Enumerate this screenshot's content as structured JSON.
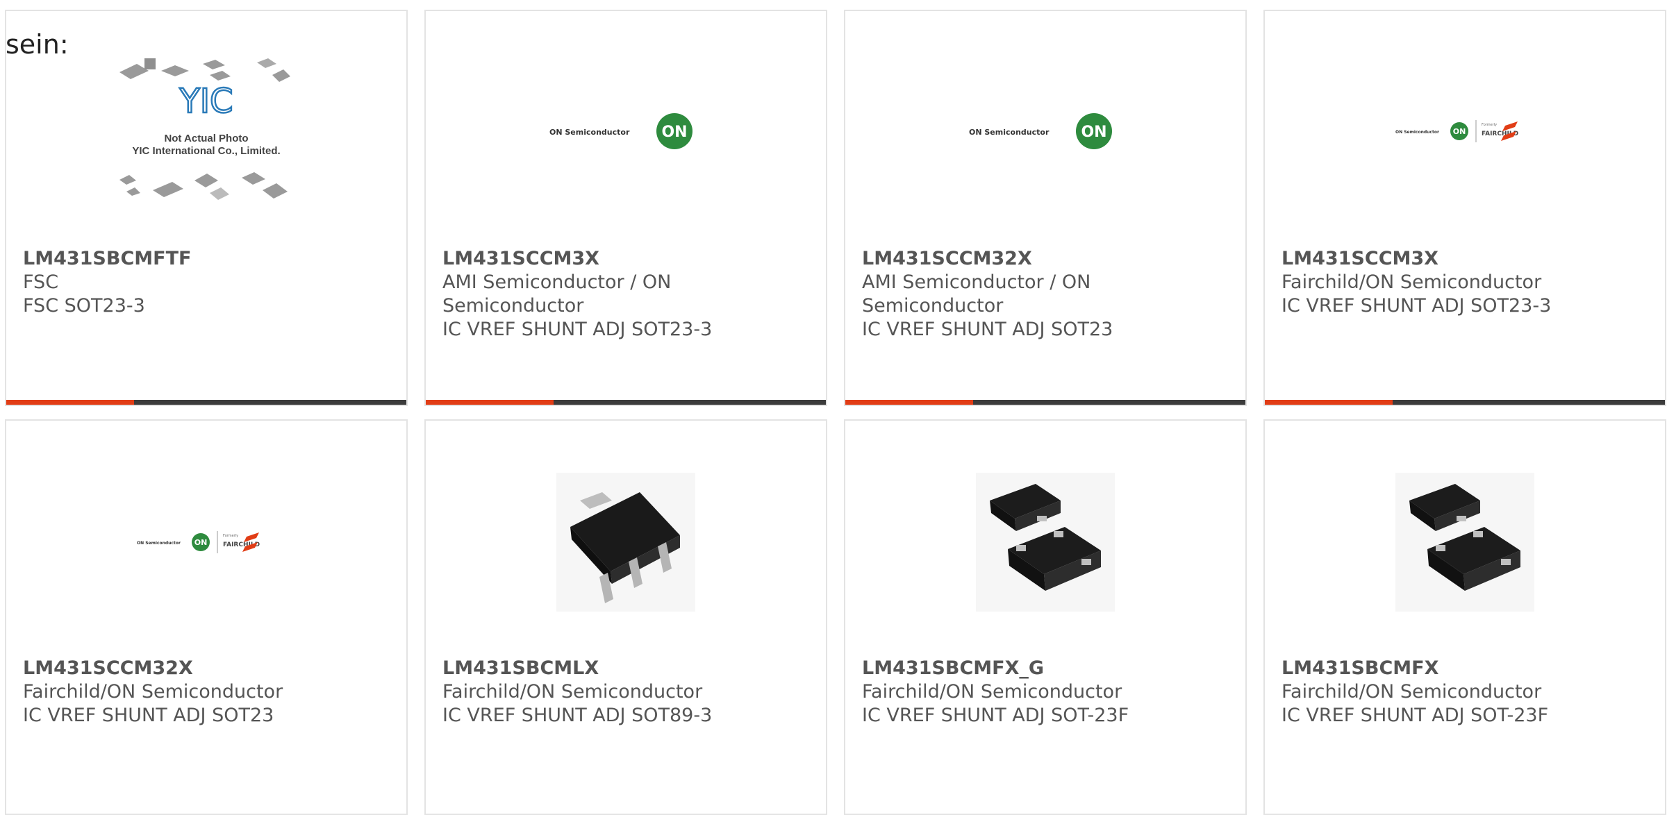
{
  "intro_text": "sein:",
  "colors": {
    "accent": "#e13d16",
    "bar": "#3c3c3c",
    "border": "#e3e3e3",
    "text": "#555555"
  },
  "products": [
    {
      "part": "LM431SBCMFTF",
      "manufacturer": "FSC",
      "description": "FSC SOT23-3",
      "image": "yic-not-actual-photo",
      "photo_caption": [
        "Not Actual Photo",
        "YIC International Co., Limited."
      ],
      "photo_logo": "YIC"
    },
    {
      "part": "LM431SCCM3X",
      "manufacturer": "AMI Semiconductor / ON Semiconductor",
      "description": "IC VREF SHUNT ADJ SOT23-3",
      "image": "on-semi-logo",
      "logo_text": "ON Semiconductor",
      "logo_badge": "ON"
    },
    {
      "part": "LM431SCCM32X",
      "manufacturer": "AMI Semiconductor / ON Semiconductor",
      "description": "IC VREF SHUNT ADJ SOT23",
      "image": "on-semi-logo",
      "logo_text": "ON Semiconductor",
      "logo_badge": "ON"
    },
    {
      "part": "LM431SCCM3X",
      "manufacturer": "Fairchild/ON Semiconductor",
      "description": "IC VREF SHUNT ADJ SOT23-3",
      "image": "on-fairchild-logo",
      "logo_text": "ON Semiconductor",
      "logo_badge": "ON",
      "logo_formerly": "Formerly",
      "logo_fairchild": "FAIRCHILD"
    },
    {
      "part": "LM431SCCM32X",
      "manufacturer": "Fairchild/ON Semiconductor",
      "description": "IC VREF SHUNT ADJ SOT23",
      "image": "on-fairchild-logo",
      "logo_text": "ON Semiconductor",
      "logo_badge": "ON",
      "logo_formerly": "Formerly",
      "logo_fairchild": "FAIRCHILD"
    },
    {
      "part": "LM431SBCMLX",
      "manufacturer": "Fairchild/ON Semiconductor",
      "description": "IC VREF SHUNT ADJ SOT89-3",
      "image": "sot89-package"
    },
    {
      "part": "LM431SBCMFX_G",
      "manufacturer": "Fairchild/ON Semiconductor",
      "description": "IC VREF SHUNT ADJ SOT-23F",
      "image": "sot23f-package"
    },
    {
      "part": "LM431SBCMFX",
      "manufacturer": "Fairchild/ON Semiconductor",
      "description": "IC VREF SHUNT ADJ SOT-23F",
      "image": "sot23f-package"
    }
  ]
}
